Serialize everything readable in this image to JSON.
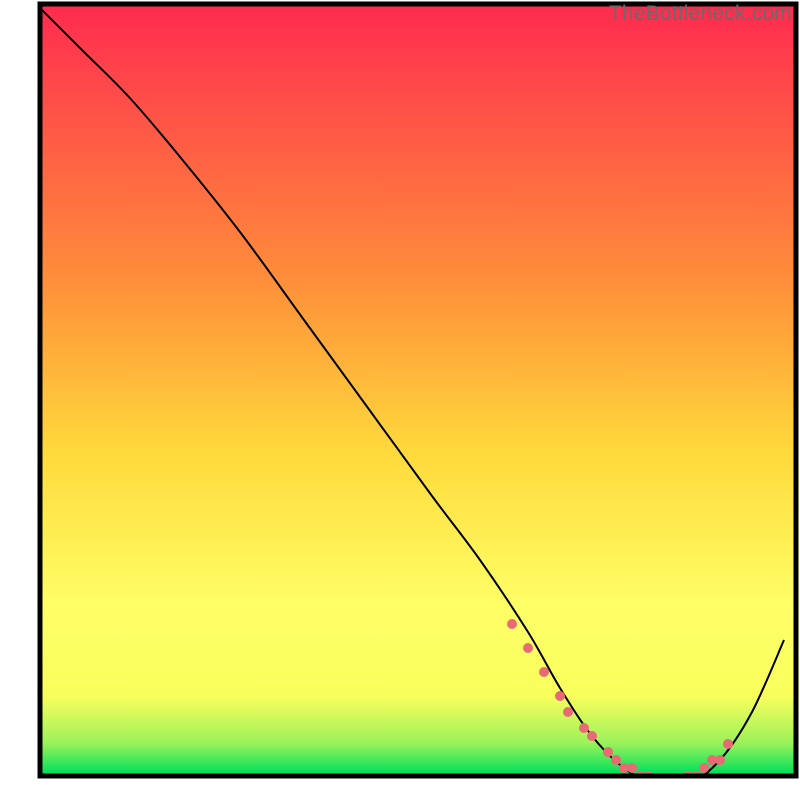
{
  "watermark": "TheBottleneck.com",
  "chart_data": {
    "type": "line",
    "title": "",
    "xlabel": "",
    "ylabel": "",
    "xlim": [
      0,
      100
    ],
    "ylim": [
      0,
      100
    ],
    "grid": false,
    "gradient": {
      "top": "#ff2b4f",
      "mid_upper": "#ff8c3a",
      "mid": "#ffd93b",
      "mid_lower": "#f8ff5c",
      "bottom": "#00e05a"
    },
    "series": [
      {
        "name": "curve",
        "color": "#000000",
        "width": 2,
        "x": [
          4,
          10,
          16,
          22,
          30,
          38,
          46,
          54,
          60,
          66,
          70,
          74,
          78,
          82,
          86,
          90,
          94,
          98
        ],
        "y": [
          100,
          94,
          88,
          81,
          71,
          60,
          49,
          38,
          30,
          21,
          14,
          8,
          4,
          2,
          2,
          5,
          11,
          20
        ]
      }
    ],
    "markers": {
      "name": "highlight-dots",
      "color": "#e76b74",
      "radius": 5,
      "x": [
        64,
        66,
        68,
        70,
        71,
        73,
        74,
        76,
        77,
        78,
        79,
        80,
        81,
        82,
        83,
        84,
        85,
        86,
        87,
        88,
        89,
        90,
        91
      ],
      "y": [
        22,
        19,
        16,
        13,
        11,
        9,
        8,
        6,
        5,
        4,
        4,
        3,
        3,
        2,
        2,
        2,
        2,
        3,
        3,
        4,
        5,
        5,
        7
      ]
    },
    "axes_box": {
      "x0": 5,
      "y0": 3,
      "x1": 99.5,
      "y1": 99.5,
      "stroke": "#000000",
      "stroke_width": 5
    }
  }
}
